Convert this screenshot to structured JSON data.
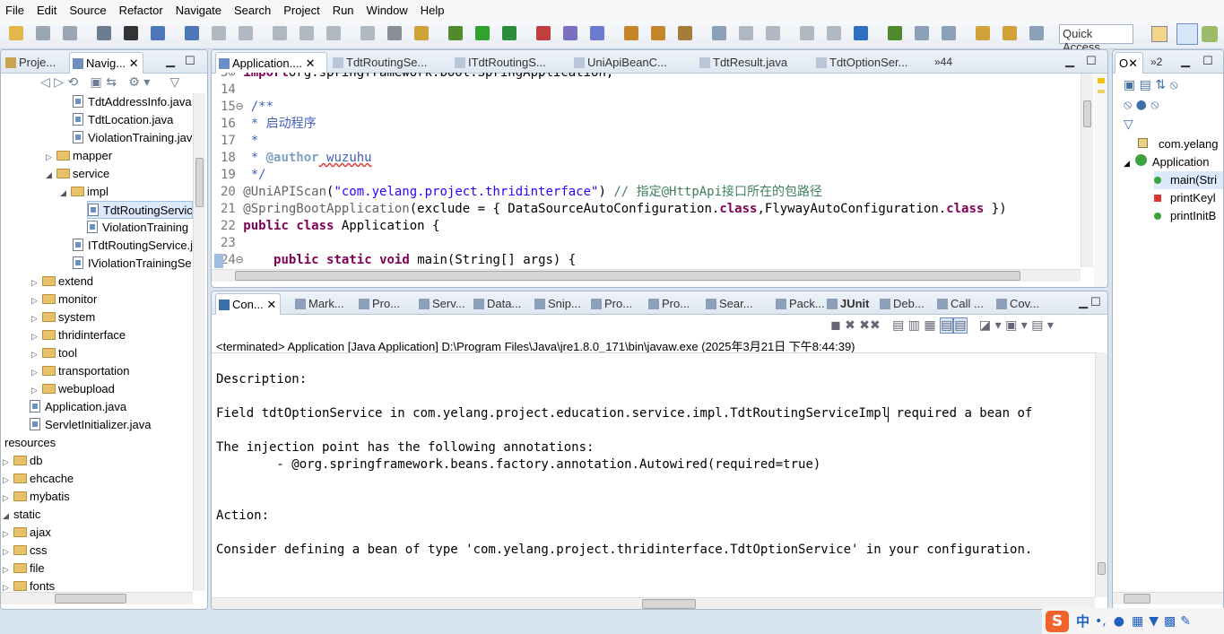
{
  "menu": [
    "File",
    "Edit",
    "Source",
    "Refactor",
    "Navigate",
    "Search",
    "Project",
    "Run",
    "Window",
    "Help"
  ],
  "quick_access": "Quick Access",
  "left_panel": {
    "tabs": [
      "Proje...",
      "Navig..."
    ],
    "tree": [
      {
        "label": "TdtAddressInfo.java",
        "kind": "java",
        "indent": 80
      },
      {
        "label": "TdtLocation.java",
        "kind": "java",
        "indent": 80
      },
      {
        "label": "ViolationTraining.jav",
        "kind": "java",
        "indent": 80
      },
      {
        "label": "mapper",
        "kind": "folder",
        "arrow": "▷",
        "indent": 50
      },
      {
        "label": "service",
        "kind": "folder",
        "arrow": "◢",
        "indent": 50
      },
      {
        "label": "impl",
        "kind": "folder",
        "arrow": "◢",
        "indent": 66
      },
      {
        "label": "TdtRoutingServic",
        "kind": "java",
        "indent": 96,
        "selected": true
      },
      {
        "label": "ViolationTraining",
        "kind": "java",
        "indent": 96
      },
      {
        "label": "ITdtRoutingService.j",
        "kind": "java",
        "indent": 80
      },
      {
        "label": "IViolationTrainingSe",
        "kind": "java",
        "indent": 80
      },
      {
        "label": "extend",
        "kind": "folder",
        "arrow": "▷",
        "indent": 34
      },
      {
        "label": "monitor",
        "kind": "folder",
        "arrow": "▷",
        "indent": 34
      },
      {
        "label": "system",
        "kind": "folder",
        "arrow": "▷",
        "indent": 34
      },
      {
        "label": "thridinterface",
        "kind": "folder",
        "arrow": "▷",
        "indent": 34
      },
      {
        "label": "tool",
        "kind": "folder",
        "arrow": "▷",
        "indent": 34
      },
      {
        "label": "transportation",
        "kind": "folder",
        "arrow": "▷",
        "indent": 34
      },
      {
        "label": "webupload",
        "kind": "folder",
        "arrow": "▷",
        "indent": 34
      },
      {
        "label": "Application.java",
        "kind": "java",
        "indent": 32
      },
      {
        "label": "ServletInitializer.java",
        "kind": "java",
        "indent": 32
      },
      {
        "label": "resources",
        "kind": "plain",
        "indent": 4
      },
      {
        "label": "db",
        "kind": "folder",
        "arrow": "▷",
        "indent": 2
      },
      {
        "label": "ehcache",
        "kind": "folder",
        "arrow": "▷",
        "indent": 2
      },
      {
        "label": "mybatis",
        "kind": "folder",
        "arrow": "▷",
        "indent": 2
      },
      {
        "label": "static",
        "kind": "plain",
        "arrow": "◢",
        "indent": 2
      },
      {
        "label": "ajax",
        "kind": "folder",
        "arrow": "▷",
        "indent": 2
      },
      {
        "label": "css",
        "kind": "folder",
        "arrow": "▷",
        "indent": 2
      },
      {
        "label": "file",
        "kind": "folder",
        "arrow": "▷",
        "indent": 2
      },
      {
        "label": "fonts",
        "kind": "folder",
        "arrow": "▷",
        "indent": 2
      }
    ]
  },
  "editor": {
    "tabs": [
      "Application....",
      "TdtRoutingSe...",
      "ITdtRoutingS...",
      "UniApiBeanC...",
      "TdtResult.java",
      "TdtOptionSer..."
    ],
    "overflow": "»44",
    "lines": [
      {
        "n": "3⊕",
        "parts": [
          [
            "kw",
            "import"
          ],
          [
            "",
            "org.springframework.boot.SpringApplication;"
          ]
        ]
      },
      {
        "n": "14",
        "parts": []
      },
      {
        "n": "15⊖",
        "parts": [
          [
            "cm",
            "/**"
          ]
        ]
      },
      {
        "n": "16",
        "parts": [
          [
            "cm",
            " * 启动程序"
          ]
        ]
      },
      {
        "n": "17",
        "parts": [
          [
            "cm",
            " *"
          ]
        ]
      },
      {
        "n": "18",
        "parts": [
          [
            "cm",
            " * "
          ],
          [
            "tg",
            "@author"
          ],
          [
            "cm",
            " wuzuhu"
          ]
        ]
      },
      {
        "n": "19",
        "parts": [
          [
            "cm",
            " */"
          ]
        ]
      },
      {
        "n": "20",
        "parts": [
          [
            "an",
            "@UniAPIScan"
          ],
          [
            "",
            "("
          ],
          [
            "st",
            "\"com.yelang.project.thridinterface\""
          ],
          [
            "",
            ") "
          ],
          [
            "cc",
            "// 指定@HttpApi接口所在的包路径"
          ]
        ]
      },
      {
        "n": "21",
        "parts": [
          [
            "an",
            "@SpringBootApplication"
          ],
          [
            "",
            "(exclude = { DataSourceAutoConfiguration."
          ],
          [
            "kw",
            "class"
          ],
          [
            "",
            ",FlywayAutoConfiguration."
          ],
          [
            "kw",
            "class"
          ],
          [
            "",
            " })"
          ]
        ]
      },
      {
        "n": "22",
        "parts": [
          [
            "kw",
            "public"
          ],
          [
            "",
            " "
          ],
          [
            "kw",
            "class"
          ],
          [
            "",
            " Application {"
          ]
        ]
      },
      {
        "n": "23",
        "parts": []
      },
      {
        "n": "24⊖",
        "parts": [
          [
            "",
            "   "
          ],
          [
            "kw",
            "public"
          ],
          [
            "",
            " "
          ],
          [
            "kw",
            "static"
          ],
          [
            "",
            " "
          ],
          [
            "kw",
            "void"
          ],
          [
            "",
            " main(String[] args) {"
          ]
        ]
      }
    ]
  },
  "bottom_panel": {
    "tabs": [
      "Con...",
      "Mark...",
      "Pro...",
      "Serv...",
      "Data...",
      "Snip...",
      "Pro...",
      "Pro...",
      "Sear...",
      "Pack...",
      "JUnit",
      "Deb...",
      "Call ...",
      "Cov..."
    ],
    "status": "<terminated> Application [Java Application] D:\\Program Files\\Java\\jre1.8.0_171\\bin\\javaw.exe (2025年3月21日 下午8:44:39)",
    "lines": [
      "Description:",
      "",
      "Field tdtOptionService in com.yelang.project.education.service.impl.TdtRoutingServiceImpl required a bean of",
      "",
      "The injection point has the following annotations:",
      "        - @org.springframework.beans.factory.annotation.Autowired(required=true)",
      "",
      "",
      "Action:",
      "",
      "Consider defining a bean of type 'com.yelang.project.thridinterface.TdtOptionService' in your configuration."
    ]
  },
  "outline": {
    "tab": "O",
    "overflow": "»2",
    "items": [
      {
        "label": "com.yelang",
        "kind": "pkg"
      },
      {
        "label": "Application",
        "kind": "class"
      },
      {
        "label": "main(Stri",
        "kind": "method"
      },
      {
        "label": "printKeyl",
        "kind": "field"
      },
      {
        "label": "printInitB",
        "kind": "method"
      }
    ]
  },
  "ime": {
    "lang": "中"
  }
}
